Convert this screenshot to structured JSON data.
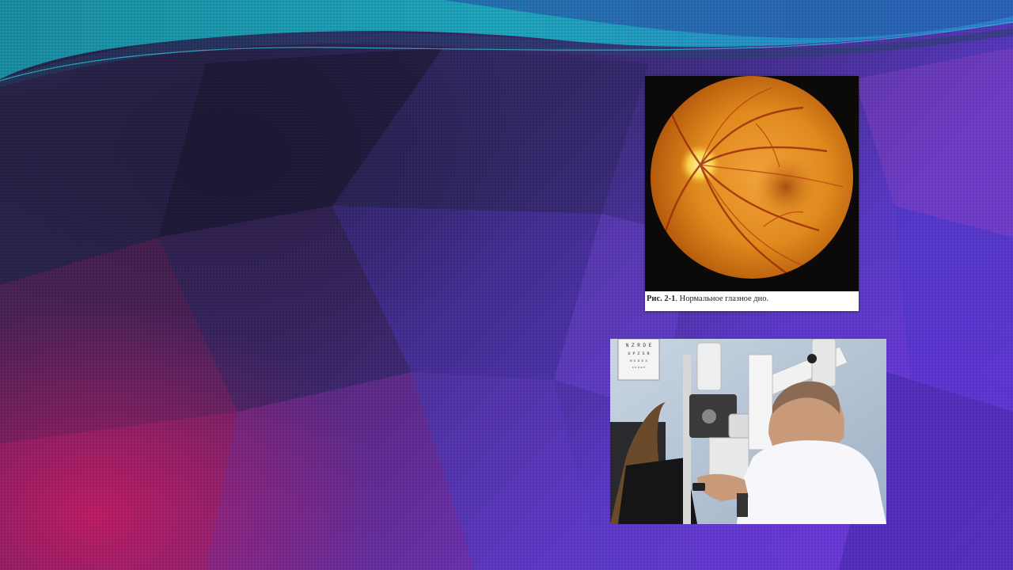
{
  "slide": {
    "fundus_figure": {
      "caption_label": "Рис. 2-1",
      "caption_text": ". Нормальное глазное дно."
    },
    "exam_photo": {
      "eye_chart_rows": [
        "N Z R D E",
        "U P Z S R",
        "R E D E S",
        "D U R E P"
      ]
    }
  },
  "colors": {
    "background_top": "#2a2548",
    "background_magenta": "#d71e6e",
    "background_violet": "#6d3ed8",
    "wave_teal": "#1aa3b8",
    "fundus_orange": "#e08a1e"
  },
  "icons": {
    "fundus": "fundus-photo",
    "exam": "slit-lamp-exam-photo"
  }
}
